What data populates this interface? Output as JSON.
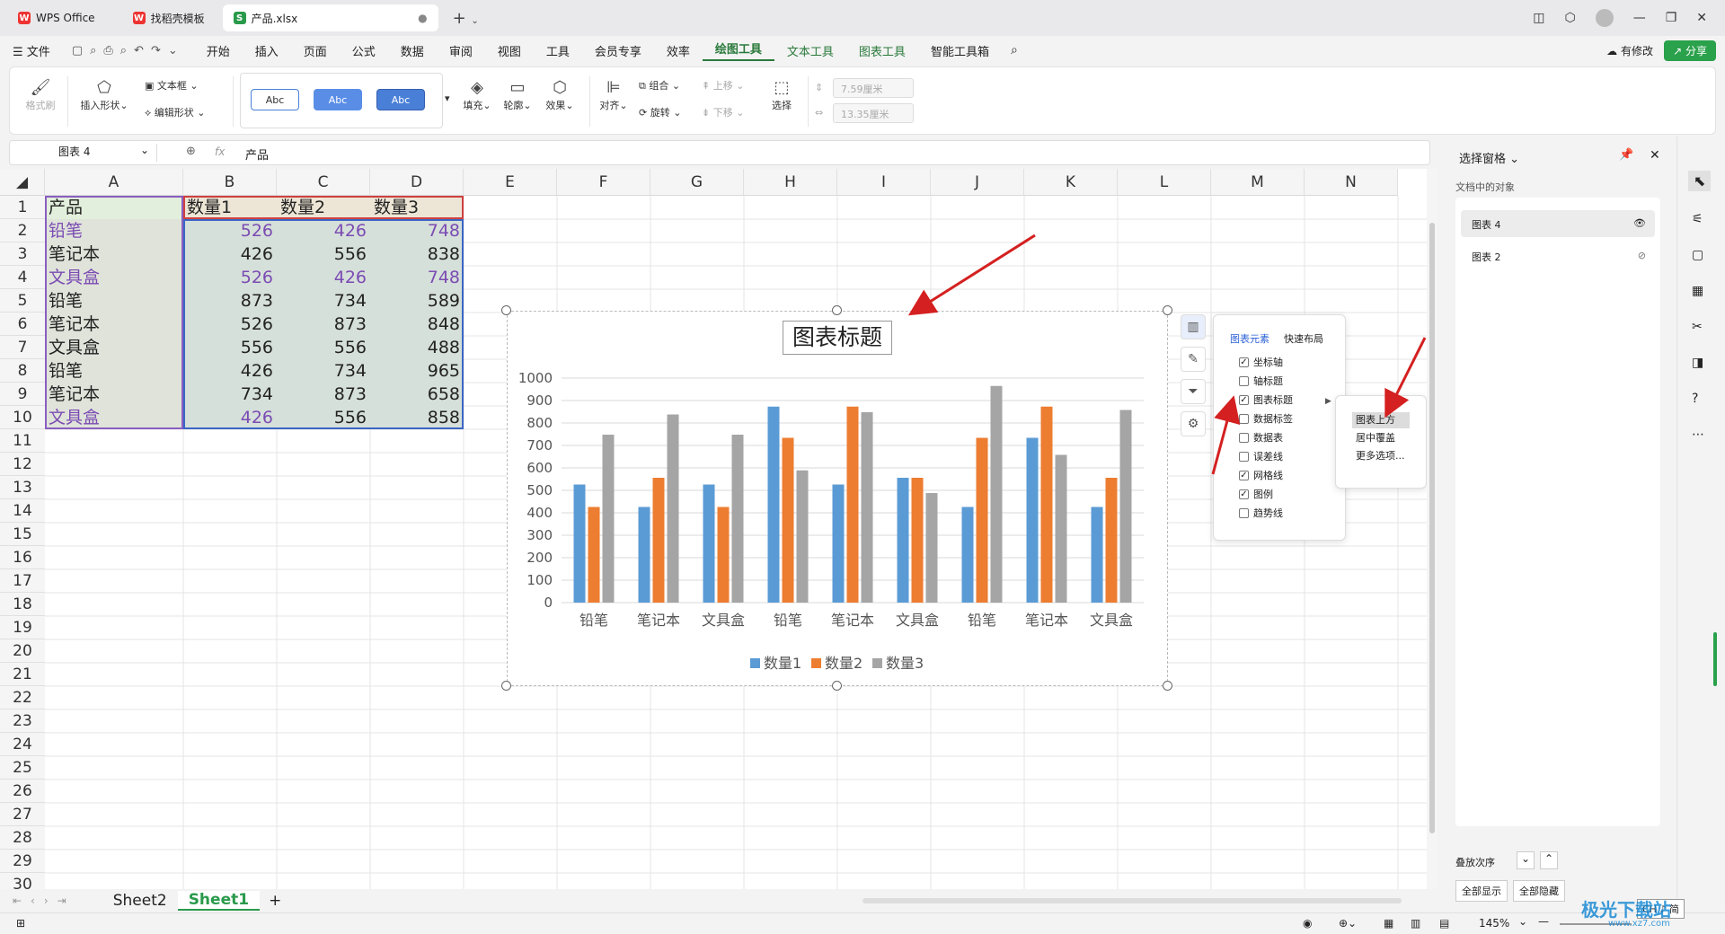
{
  "tabs": [
    {
      "label": "WPS Office",
      "icon": "W"
    },
    {
      "label": "找稻壳模板",
      "icon": "W"
    },
    {
      "label": "产品.xlsx",
      "icon": "S"
    }
  ],
  "menu": {
    "file": "文件",
    "items": [
      "开始",
      "插入",
      "页面",
      "公式",
      "数据",
      "审阅",
      "视图",
      "工具",
      "会员专享",
      "效率",
      "绘图工具",
      "文本工具",
      "图表工具",
      "智能工具箱"
    ],
    "active": "绘图工具",
    "revise": "有修改",
    "share": "分享"
  },
  "ribbon": {
    "format_brush": "格式刷",
    "insert_shape": "插入形状",
    "textbox": "文本框",
    "edit_shape": "编辑形状",
    "abc": "Abc",
    "fill": "填充",
    "outline": "轮廓",
    "effect": "效果",
    "align": "对齐",
    "group": "组合",
    "rotate": "旋转",
    "up": "上移",
    "down": "下移",
    "select": "选择",
    "height": "7.59厘米",
    "width": "13.35厘米"
  },
  "formula": {
    "name_box": "图表 4",
    "fx": "fx",
    "value": "产品"
  },
  "columns": [
    "A",
    "B",
    "C",
    "D",
    "E",
    "F",
    "G",
    "H",
    "I",
    "J",
    "K",
    "L",
    "M",
    "N"
  ],
  "rows": [
    "1",
    "2",
    "3",
    "4",
    "5",
    "6",
    "7",
    "8",
    "9",
    "10",
    "11",
    "12",
    "13",
    "14",
    "15",
    "16",
    "17",
    "18",
    "19",
    "20",
    "21",
    "22",
    "23",
    "24",
    "25",
    "26",
    "27",
    "28",
    "29",
    "30"
  ],
  "table": {
    "headers": [
      "产品",
      "数量1",
      "数量2",
      "数量3"
    ],
    "data": [
      [
        "铅笔",
        "526",
        "426",
        "748"
      ],
      [
        "笔记本",
        "426",
        "556",
        "838"
      ],
      [
        "文具盒",
        "526",
        "426",
        "748"
      ],
      [
        "铅笔",
        "873",
        "734",
        "589"
      ],
      [
        "笔记本",
        "526",
        "873",
        "848"
      ],
      [
        "文具盒",
        "556",
        "556",
        "488"
      ],
      [
        "铅笔",
        "426",
        "734",
        "965"
      ],
      [
        "笔记本",
        "734",
        "873",
        "658"
      ],
      [
        "文具盒",
        "426",
        "556",
        "858"
      ]
    ]
  },
  "chart_data": {
    "type": "bar",
    "title": "图表标题",
    "categories": [
      "铅笔",
      "笔记本",
      "文具盒",
      "铅笔",
      "笔记本",
      "文具盒",
      "铅笔",
      "笔记本",
      "文具盒"
    ],
    "series": [
      {
        "name": "数量1",
        "color": "#5b9bd5",
        "values": [
          526,
          426,
          526,
          873,
          526,
          556,
          426,
          734,
          426
        ]
      },
      {
        "name": "数量2",
        "color": "#ed7d31",
        "values": [
          426,
          556,
          426,
          734,
          873,
          556,
          734,
          873,
          556
        ]
      },
      {
        "name": "数量3",
        "color": "#a5a5a5",
        "values": [
          748,
          838,
          748,
          589,
          848,
          488,
          965,
          658,
          858
        ]
      }
    ],
    "ylim": [
      0,
      1000
    ],
    "yticks": [
      "0",
      "100",
      "200",
      "300",
      "400",
      "500",
      "600",
      "700",
      "800",
      "900",
      "1000"
    ],
    "grid": true,
    "legend": "bottom"
  },
  "popup": {
    "tab1": "图表元素",
    "tab2": "快速布局",
    "items": [
      {
        "label": "坐标轴",
        "checked": true
      },
      {
        "label": "轴标题",
        "checked": false
      },
      {
        "label": "图表标题",
        "checked": true
      },
      {
        "label": "数据标签",
        "checked": false
      },
      {
        "label": "数据表",
        "checked": false
      },
      {
        "label": "误差线",
        "checked": false
      },
      {
        "label": "网格线",
        "checked": true
      },
      {
        "label": "图例",
        "checked": true
      },
      {
        "label": "趋势线",
        "checked": false
      }
    ]
  },
  "submenu": {
    "items": [
      "图表上方",
      "居中覆盖",
      "更多选项..."
    ]
  },
  "pane": {
    "title": "选择窗格",
    "objects_label": "文档中的对象",
    "objects": [
      "图表 4",
      "图表 2"
    ],
    "order_label": "叠放次序",
    "show_all": "全部显示",
    "hide_all": "全部隐藏"
  },
  "sheets": [
    "Sheet2",
    "Sheet1"
  ],
  "active_sheet": "Sheet1",
  "status": {
    "zoom": "145%",
    "ime": "CH ♪ 简"
  },
  "watermark": {
    "text": "极光下载站",
    "url": "www.xz7.com"
  }
}
